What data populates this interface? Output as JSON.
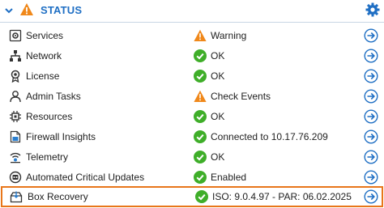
{
  "header": {
    "title": "STATUS",
    "icons": {
      "collapse": "chevron-down-icon",
      "status": "warning-icon",
      "settings": "gear-icon"
    }
  },
  "colors": {
    "accent": "#1f6fc4",
    "ok": "#3fae29",
    "warning": "#f0881a",
    "highlight": "#e8761a"
  },
  "rows": [
    {
      "label": "Services",
      "icon": "services-icon",
      "status": "warning",
      "value": "Warning"
    },
    {
      "label": "Network",
      "icon": "network-icon",
      "status": "ok",
      "value": "OK"
    },
    {
      "label": "License",
      "icon": "license-icon",
      "status": "ok",
      "value": "OK"
    },
    {
      "label": "Admin Tasks",
      "icon": "admin-tasks-icon",
      "status": "warning",
      "value": "Check Events"
    },
    {
      "label": "Resources",
      "icon": "resources-icon",
      "status": "ok",
      "value": "OK"
    },
    {
      "label": "Firewall Insights",
      "icon": "firewall-insights-icon",
      "status": "ok",
      "value": "Connected to 10.17.76.209"
    },
    {
      "label": "Telemetry",
      "icon": "telemetry-icon",
      "status": "ok",
      "value": "OK"
    },
    {
      "label": "Automated Critical Updates",
      "icon": "automated-updates-icon",
      "status": "ok",
      "value": "Enabled"
    },
    {
      "label": "Box Recovery",
      "icon": "box-recovery-icon",
      "status": "ok",
      "value": "ISO: 9.0.4.97 - PAR: 06.02.2025",
      "highlighted": true
    }
  ]
}
